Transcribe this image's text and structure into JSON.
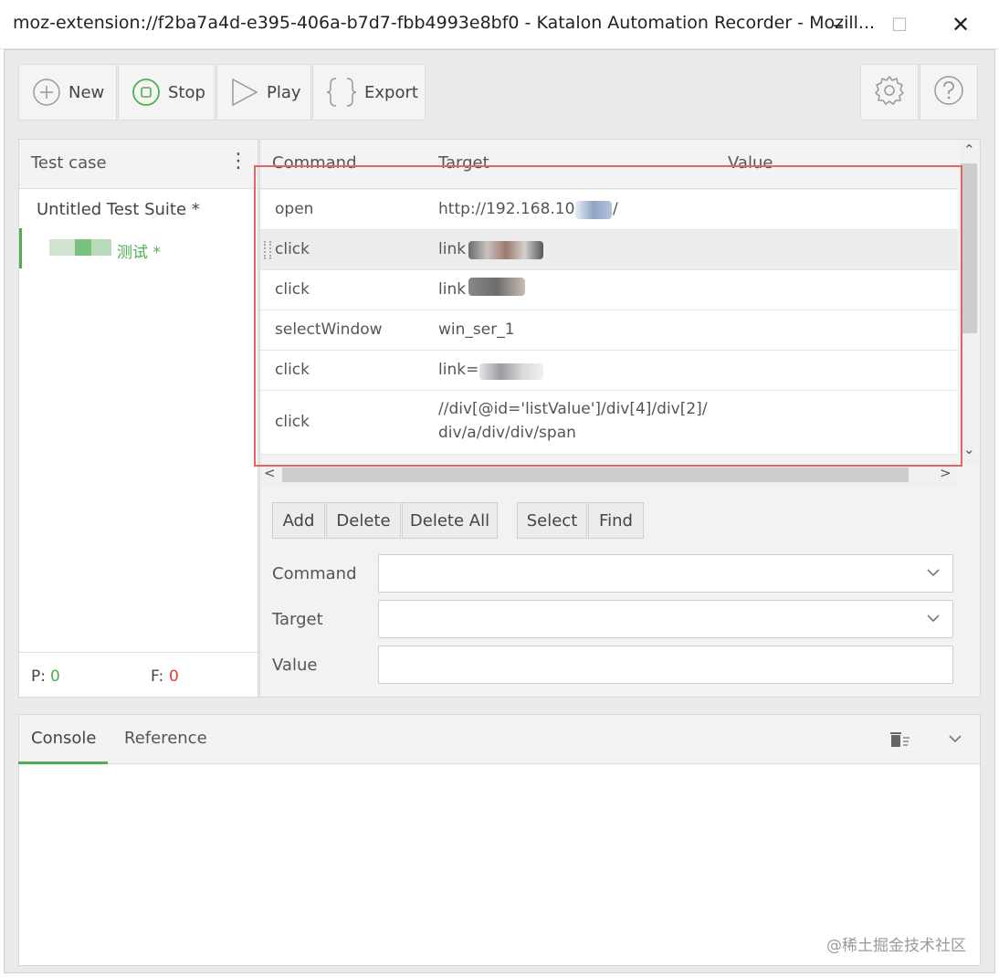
{
  "window": {
    "title": "moz-extension://f2ba7a4d-e395-406a-b7d7-fbb4993e8bf0 - Katalon Automation Recorder - Mozill...",
    "minimize_label": "–",
    "maximize_label": "☐",
    "close_label": "✕"
  },
  "toolbar": {
    "new_label": "New",
    "stop_label": "Stop",
    "play_label": "Play",
    "export_label": "Export"
  },
  "testcase_panel": {
    "header": "Test case",
    "menu_label": "⋮",
    "suite_name": "Untitled Test Suite *",
    "case_name": "测试 *",
    "pass_label": "P:",
    "pass_count": "0",
    "fail_label": "F:",
    "fail_count": "0"
  },
  "grid": {
    "columns": [
      "Command",
      "Target",
      "Value"
    ],
    "rows": [
      {
        "command": "open",
        "target": "http://192.168.10",
        "target_suffix": "/",
        "value": ""
      },
      {
        "command": "click",
        "target": "link",
        "value": ""
      },
      {
        "command": "click",
        "target": "link",
        "value": ""
      },
      {
        "command": "selectWindow",
        "target": "win_ser_1",
        "value": ""
      },
      {
        "command": "click",
        "target": "link=",
        "value": ""
      },
      {
        "command": "click",
        "target": "//div[@id='listValue']/div[4]/div[2]/",
        "target_line2": "div/a/div/div/span",
        "value": ""
      }
    ],
    "scroll_left": "<",
    "scroll_right": ">"
  },
  "actions": {
    "add": "Add",
    "delete": "Delete",
    "delete_all": "Delete All",
    "select": "Select",
    "find": "Find"
  },
  "editor": {
    "command_label": "Command",
    "target_label": "Target",
    "value_label": "Value"
  },
  "console": {
    "tab_console": "Console",
    "tab_reference": "Reference"
  },
  "watermark": "@稀土掘金技术社区",
  "colors": {
    "accent_green": "#4caf50",
    "fail_red": "#e53935",
    "highlight_red": "#e06666"
  }
}
